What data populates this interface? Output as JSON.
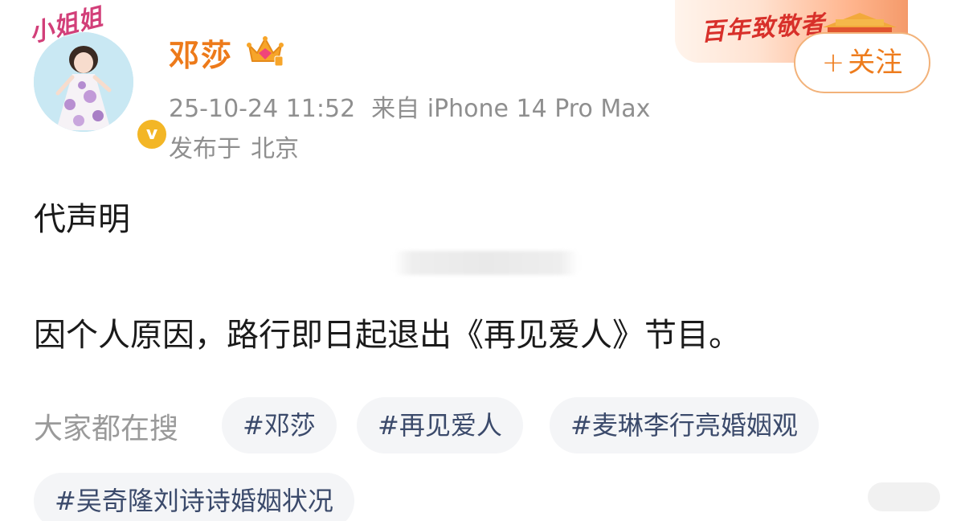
{
  "user": {
    "name": "邓莎",
    "avatar_caption": "小姐姐",
    "verified_mark": "v",
    "name_color": "#ed7a1a"
  },
  "post_meta": {
    "timestamp": "25-10-24 11:52",
    "source": "来自 iPhone 14 Pro Max",
    "location_prefix": "发布于",
    "location": "北京"
  },
  "banner": {
    "text": "百年致敬者"
  },
  "follow_button": {
    "plus": "+",
    "label": "关注"
  },
  "post": {
    "title": "代声明",
    "body": "因个人原因，路行即日起退出《再见爱人》节目。"
  },
  "trending": {
    "label": "大家都在搜",
    "tags": [
      "#邓莎",
      "#再见爱人",
      "#麦琳李行亮婚姻观",
      "#吴奇隆刘诗诗婚姻状况"
    ]
  },
  "colors": {
    "accent": "#ee7c1d",
    "tag_text": "#3b4a6b",
    "meta_gray": "#8f8f8f"
  }
}
